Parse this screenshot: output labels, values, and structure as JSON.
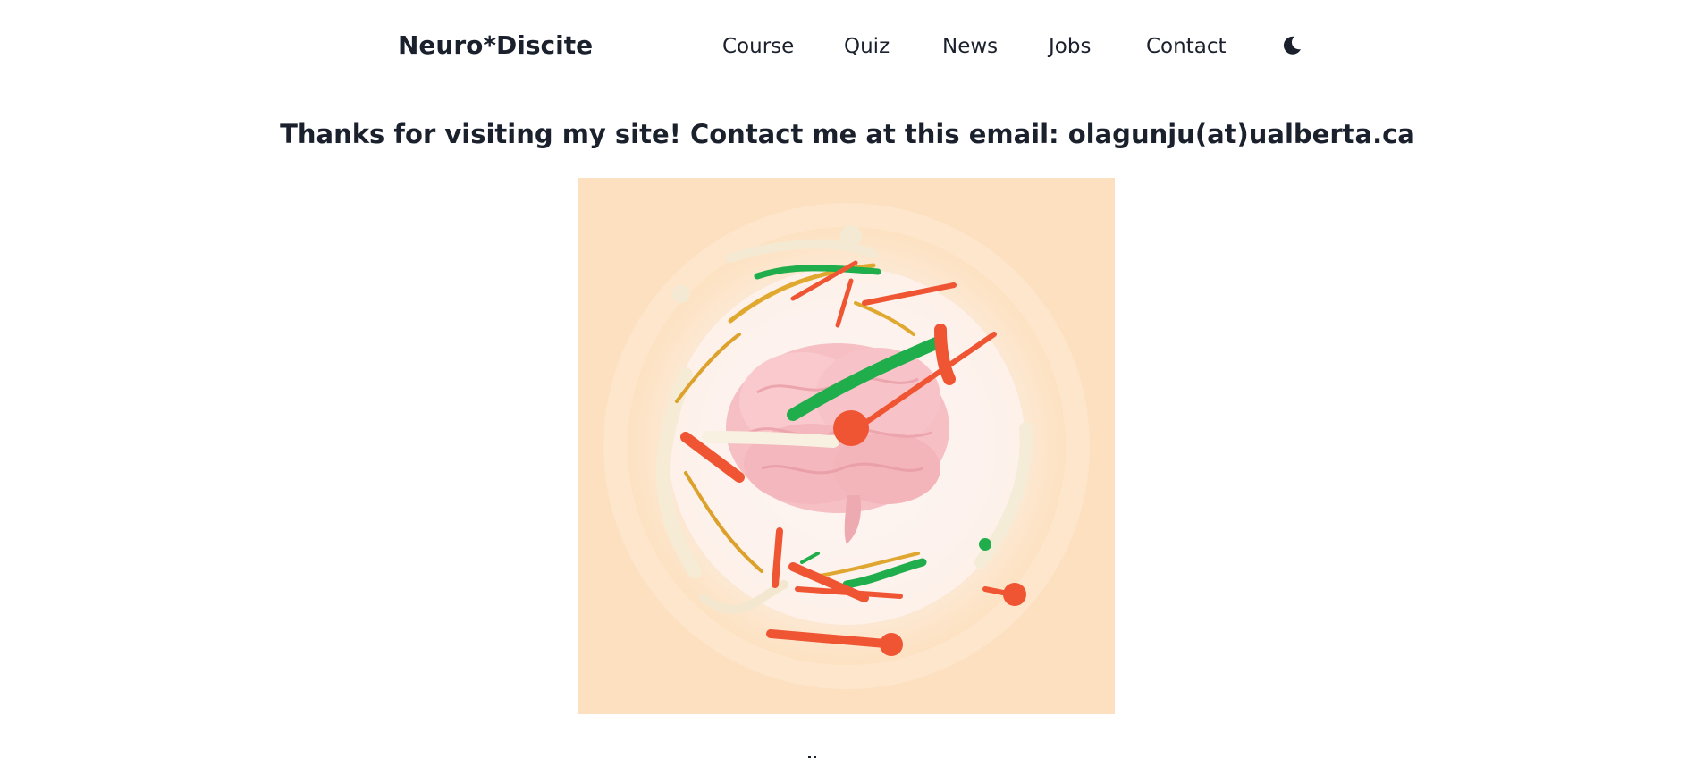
{
  "nav": {
    "brand": "Neuro*Discite",
    "links": [
      "Course",
      "Quiz",
      "News",
      "Jobs",
      "Contact"
    ],
    "theme_toggle_icon": "moon-icon"
  },
  "main": {
    "heading": "Thanks for visiting my site! Contact me at this email: olagunju(at)ualberta.ca",
    "hero_image": {
      "icon": "brain-illustration",
      "background_color": "#fde2c2",
      "colors": [
        "#f9c6c9",
        "#ef5533",
        "#1fae4b",
        "#e0a82e",
        "#f7f0df"
      ]
    }
  }
}
